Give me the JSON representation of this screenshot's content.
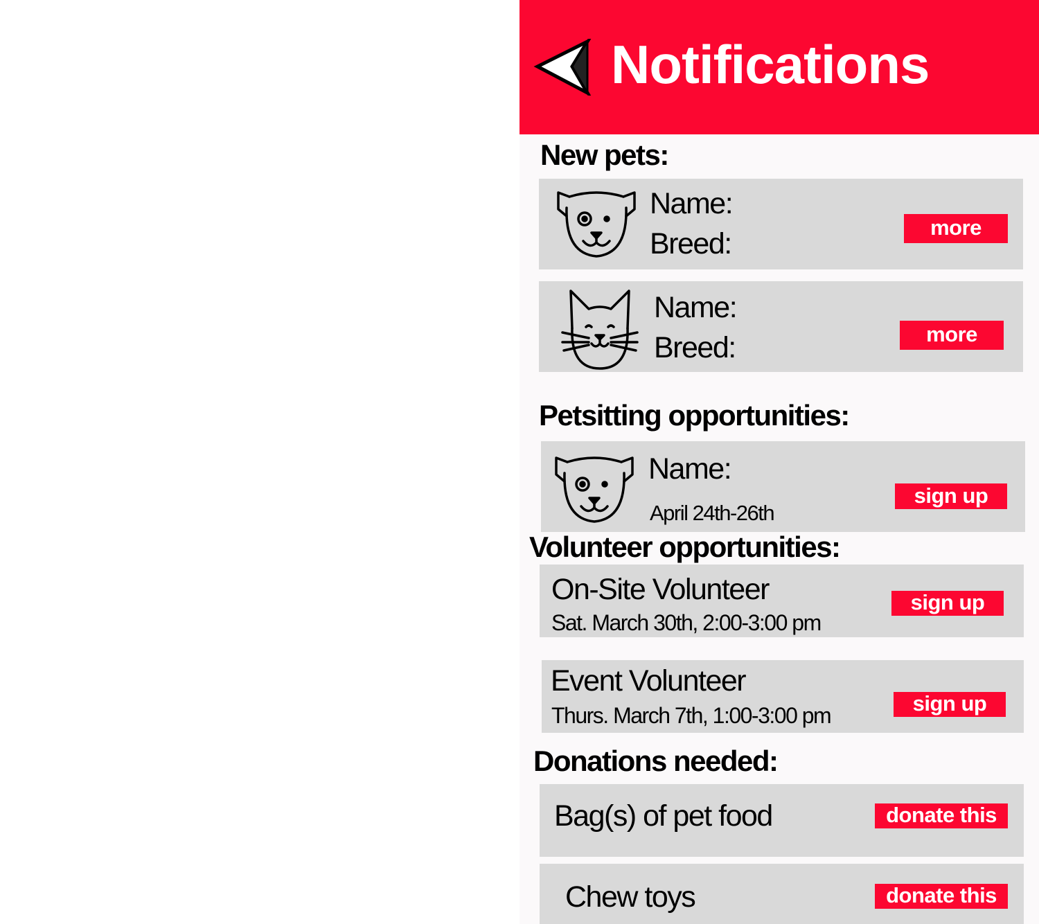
{
  "header": {
    "title": "Notifications",
    "back_icon": "back-arrow-icon"
  },
  "colors": {
    "accent": "#fc0731",
    "card": "#d9d9d9",
    "panel": "#fbf9fa"
  },
  "new_pets": {
    "title": "New pets:",
    "items": [
      {
        "icon": "dog-icon",
        "name_label": "Name:",
        "breed_label": "Breed:",
        "button": "more"
      },
      {
        "icon": "cat-icon",
        "name_label": "Name:",
        "breed_label": "Breed:",
        "button": "more"
      }
    ]
  },
  "petsitting": {
    "title": "Petsitting opportunities:",
    "items": [
      {
        "icon": "dog-icon",
        "name_label": "Name:",
        "dates": "April 24th-26th",
        "button": "sign up"
      }
    ]
  },
  "volunteer": {
    "title": "Volunteer opportunities:",
    "items": [
      {
        "title": "On-Site Volunteer",
        "when": "Sat. March 30th, 2:00-3:00 pm",
        "button": "sign up"
      },
      {
        "title": "Event Volunteer",
        "when": "Thurs. March 7th, 1:00-3:00 pm",
        "button": "sign up"
      }
    ]
  },
  "donations": {
    "title": "Donations needed:",
    "items": [
      {
        "item": "Bag(s) of pet food",
        "button": "donate this"
      },
      {
        "item": "Chew toys",
        "button": "donate this"
      }
    ]
  }
}
